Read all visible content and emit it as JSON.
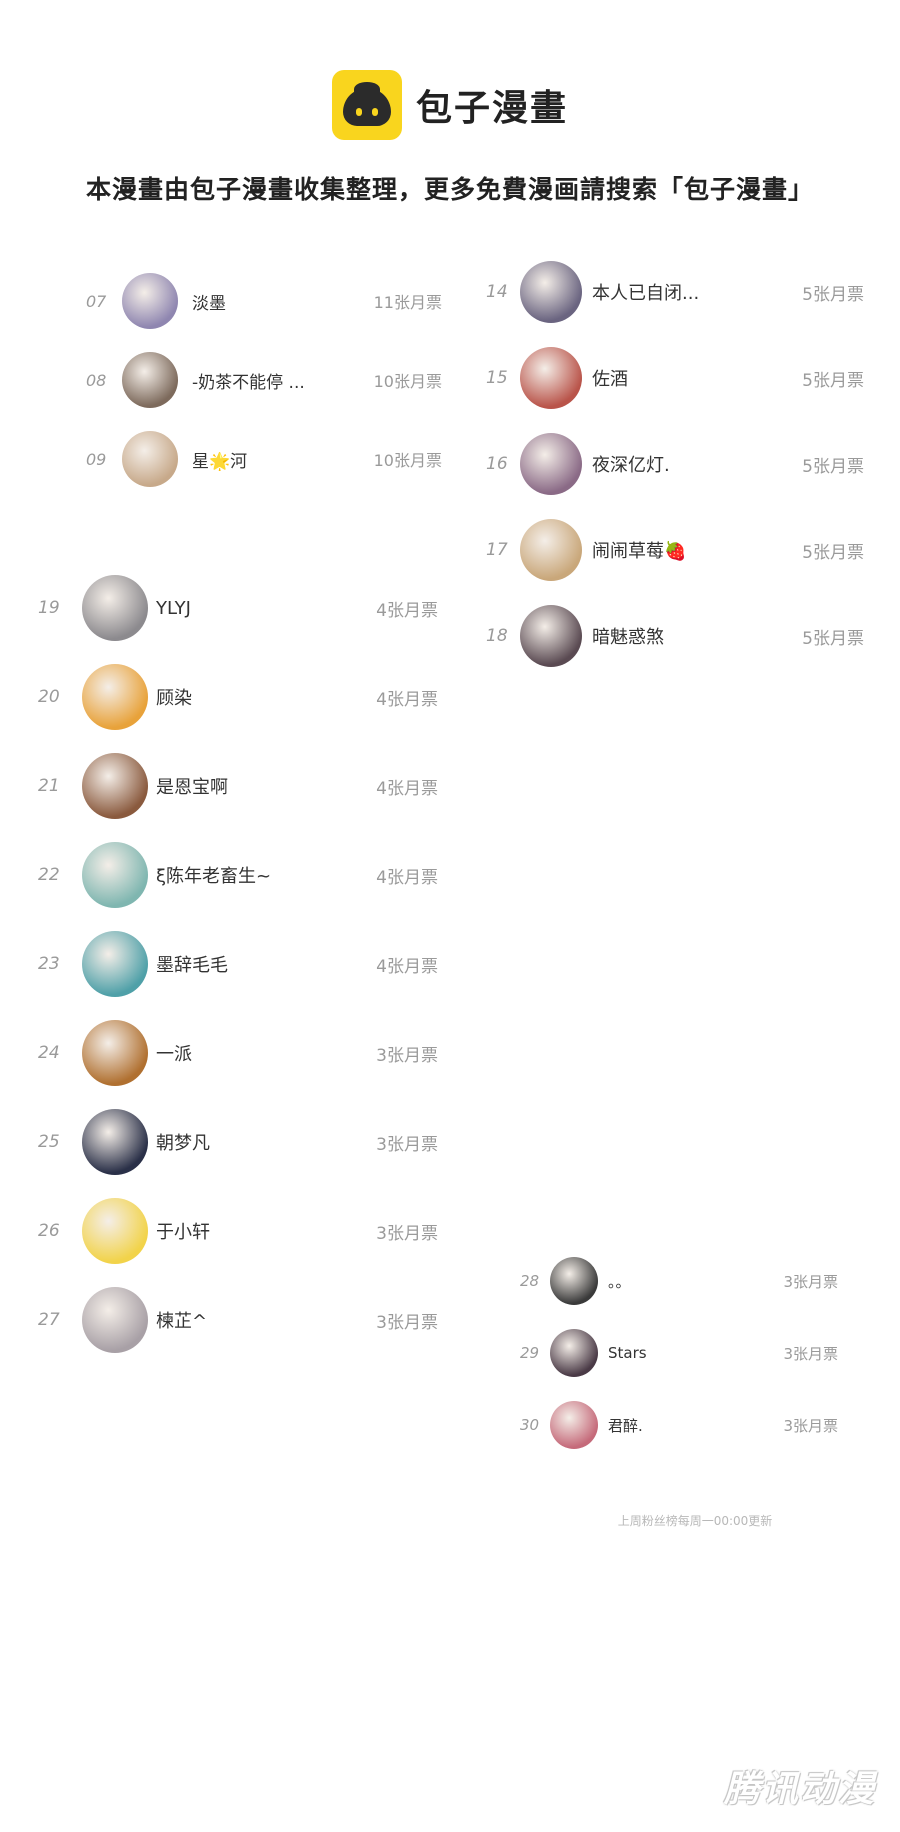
{
  "header": {
    "brand": "包子漫畫",
    "notice": "本漫畫由包子漫畫收集整理，更多免費漫画請搜索「包子漫畫」"
  },
  "panel1": [
    {
      "rank": "07",
      "name": "淡墨",
      "votes": "11张月票",
      "color": "#8f86b0"
    },
    {
      "rank": "08",
      "name": "-奶茶不能停 ...",
      "votes": "10张月票",
      "color": "#7d6a5c"
    },
    {
      "rank": "09",
      "name": "星🌟河",
      "votes": "10张月票",
      "color": "#c7a98a"
    }
  ],
  "panel2": [
    {
      "rank": "14",
      "name": "本人已自闭...",
      "votes": "5张月票",
      "color": "#6a6480"
    },
    {
      "rank": "15",
      "name": "佐酒",
      "votes": "5张月票",
      "color": "#b9544a"
    },
    {
      "rank": "16",
      "name": "夜深亿灯.",
      "votes": "5张月票",
      "color": "#8a6a86"
    },
    {
      "rank": "17",
      "name": "闹闹草莓🍓",
      "votes": "5张月票",
      "color": "#c9a77a"
    },
    {
      "rank": "18",
      "name": "暗魅惑煞",
      "votes": "5张月票",
      "color": "#5a4a52"
    }
  ],
  "panel3": [
    {
      "rank": "19",
      "name": "YLYJ",
      "votes": "4张月票",
      "color": "#8c8a8e"
    },
    {
      "rank": "20",
      "name": "顾染",
      "votes": "4张月票",
      "color": "#e8a23a"
    },
    {
      "rank": "21",
      "name": "是恩宝啊",
      "votes": "4张月票",
      "color": "#8a5a3e"
    },
    {
      "rank": "22",
      "name": "ξ陈年老畜生~",
      "votes": "4张月票",
      "color": "#7fb6b0"
    },
    {
      "rank": "23",
      "name": "墨辞毛毛",
      "votes": "4张月票",
      "color": "#4fa0a8"
    },
    {
      "rank": "24",
      "name": "一派",
      "votes": "3张月票",
      "color": "#b07030"
    },
    {
      "rank": "25",
      "name": "朝梦凡",
      "votes": "3张月票",
      "color": "#2a3048"
    },
    {
      "rank": "26",
      "name": "于小轩",
      "votes": "3张月票",
      "color": "#f2d34a"
    },
    {
      "rank": "27",
      "name": "楝芷^",
      "votes": "3张月票",
      "color": "#a8a0a6"
    }
  ],
  "panel4": [
    {
      "rank": "28",
      "name": "。。",
      "votes": "3张月票",
      "color": "#3a3a3a"
    },
    {
      "rank": "29",
      "name": "Stars",
      "votes": "3张月票",
      "color": "#4a3a46"
    },
    {
      "rank": "30",
      "name": "君醉.",
      "votes": "3张月票",
      "color": "#c56a7a"
    }
  ],
  "footer_note": "上周粉丝榜每周一00:00更新",
  "watermark": "腾讯动漫"
}
